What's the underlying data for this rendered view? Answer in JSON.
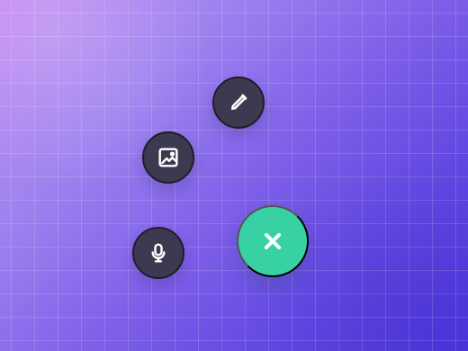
{
  "screen": {
    "background_start": "#c48af2",
    "background_end": "#4b34dc",
    "grid_color": "#ffffff"
  },
  "actions": [
    {
      "icon": "pencil-icon",
      "color": "#3d3950"
    },
    {
      "icon": "image-icon",
      "color": "#3d3950"
    },
    {
      "icon": "microphone-icon",
      "color": "#3d3950"
    }
  ],
  "main_action": {
    "icon": "close-icon",
    "color": "#37d1a3"
  }
}
